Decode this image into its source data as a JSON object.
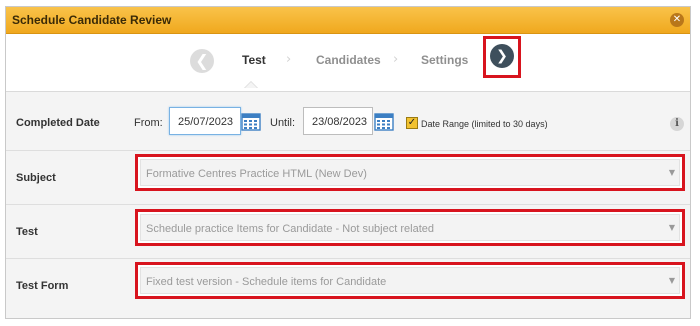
{
  "dialog": {
    "title": "Schedule Candidate Review",
    "close_icon": "close-icon"
  },
  "wizard": {
    "prev_glyph": "❮",
    "next_glyph": "❯",
    "separator_glyph": "›",
    "steps": [
      {
        "label": "Test",
        "active": true
      },
      {
        "label": "Candidates",
        "active": false
      },
      {
        "label": "Settings",
        "active": false
      }
    ]
  },
  "completed_date": {
    "label": "Completed Date",
    "from_label": "From:",
    "from_value": "25/07/2023",
    "until_label": "Until:",
    "until_value": "23/08/2023",
    "checkbox_checked": true,
    "checkbox_glyph": "✓",
    "range_label": "Date Range (limited to 30 days)",
    "info_glyph": "i"
  },
  "subject": {
    "label": "Subject",
    "value": "Formative Centres Practice HTML (New Dev)"
  },
  "test": {
    "label": "Test",
    "value": "Schedule practice Items for Candidate - Not subject related"
  },
  "test_form": {
    "label": "Test Form",
    "value": "Fixed test version - Schedule items for Candidate"
  },
  "select_arrow_glyph": "▼",
  "colors": {
    "title_bar": "#f0a81e",
    "highlight": "#d8141e",
    "next_button": "#3e4f5c",
    "calendar": "#3c7fc3"
  }
}
